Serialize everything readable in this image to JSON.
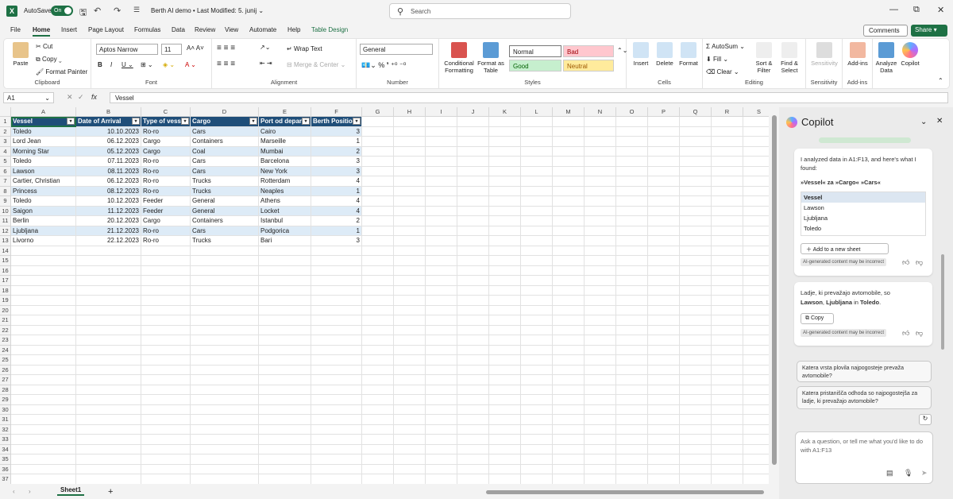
{
  "titlebar": {
    "app_letter": "X",
    "autosave_label": "AutoSave",
    "toggle": "On",
    "doc_title": "Berth AI demo • Last Modified: 5. junij ⌄",
    "search_placeholder": "Search",
    "controls": [
      "—",
      "⧉",
      "✕"
    ]
  },
  "tabs": [
    "File",
    "Home",
    "Insert",
    "Page Layout",
    "Formulas",
    "Data",
    "Review",
    "View",
    "Automate",
    "Help",
    "Table Design"
  ],
  "comments_label": "Comments",
  "share_label": "Share",
  "ribbon": {
    "clipboard": {
      "paste": "Paste",
      "cut": "Cut",
      "copy": "Copy",
      "format_painter": "Format Painter",
      "label": "Clipboard"
    },
    "font": {
      "name": "Aptos Narrow",
      "size": "11",
      "label": "Font"
    },
    "alignment": {
      "wrap": "Wrap Text",
      "merge": "Merge & Center",
      "label": "Alignment"
    },
    "number": {
      "format": "General",
      "label": "Number"
    },
    "styles": {
      "conditional": "Conditional Formatting",
      "format_table": "Format as Table",
      "normal": "Normal",
      "bad": "Bad",
      "good": "Good",
      "neutral": "Neutral",
      "label": "Styles"
    },
    "cells": {
      "insert": "Insert",
      "delete": "Delete",
      "format": "Format",
      "label": "Cells"
    },
    "editing": {
      "autosum": "AutoSum",
      "fill": "Fill",
      "clear": "Clear",
      "sort": "Sort & Filter",
      "find": "Find & Select",
      "label": "Editing"
    },
    "sensitivity": {
      "btn": "Sensitivity",
      "label": "Sensitivity"
    },
    "addins": {
      "btn": "Add-ins",
      "label": "Add-ins"
    },
    "analyze": "Analyze Data",
    "copilot": "Copilot"
  },
  "formula_bar": {
    "name_box": "A1",
    "fx": "fx",
    "value": "Vessel"
  },
  "columns": [
    "A",
    "B",
    "C",
    "D",
    "E",
    "F",
    "G",
    "H",
    "I",
    "J",
    "K",
    "L",
    "M",
    "N",
    "O",
    "P",
    "Q",
    "R",
    "S"
  ],
  "headers": [
    "Vessel",
    "Date of Arrival",
    "Type of vesse",
    "Cargo",
    "Port od depar",
    "Berth Position"
  ],
  "rows": [
    [
      "Toledo",
      "10.10.2023",
      "Ro-ro",
      "Cars",
      "Cairo",
      "3"
    ],
    [
      "Lord Jean",
      "06.12.2023",
      "Cargo",
      "Containers",
      "Marseille",
      "1"
    ],
    [
      "Morning Star",
      "05.12.2023",
      "Cargo",
      "Coal",
      "Mumbai",
      "2"
    ],
    [
      "Toledo",
      "07.11.2023",
      "Ro-ro",
      "Cars",
      "Barcelona",
      "3"
    ],
    [
      "Lawson",
      "08.11.2023",
      "Ro-ro",
      "Cars",
      "New York",
      "3"
    ],
    [
      "Cartier, Christian",
      "06.12.2023",
      "Ro-ro",
      "Trucks",
      "Rotterdam",
      "4"
    ],
    [
      "Princess",
      "08.12.2023",
      "Ro-ro",
      "Trucks",
      "Neaples",
      "1"
    ],
    [
      "Toledo",
      "10.12.2023",
      "Feeder",
      "General",
      "Athens",
      "4"
    ],
    [
      "Saigon",
      "11.12.2023",
      "Feeder",
      "General",
      "Locket",
      "4"
    ],
    [
      "Berlin",
      "20.12.2023",
      "Cargo",
      "Containers",
      "Istanbul",
      "2"
    ],
    [
      "Ljubljana",
      "21.12.2023",
      "Ro-ro",
      "Cars",
      "Podgorica",
      "1"
    ],
    [
      "Livorno",
      "22.12.2023",
      "Ro-ro",
      "Trucks",
      "Bari",
      "3"
    ]
  ],
  "row_numbers": [
    "1",
    "2",
    "3",
    "4",
    "5",
    "6",
    "7",
    "8",
    "9",
    "10",
    "11",
    "12",
    "13",
    "14",
    "15",
    "16",
    "17",
    "18",
    "19",
    "20",
    "21",
    "22",
    "23",
    "24",
    "25",
    "26",
    "27",
    "28",
    "29",
    "30",
    "31",
    "32",
    "33",
    "34",
    "35",
    "36",
    "37"
  ],
  "sheet_tab": "Sheet1",
  "copilot": {
    "title": "Copilot",
    "card1": {
      "intro": "I analyzed data in A1:F13, and here's what I found:",
      "heading": "»Vessel« za »Cargo« »Cars«",
      "table_header": "Vessel",
      "items": [
        "Lawson",
        "Ljubljana",
        "Toledo"
      ],
      "add_button": "Add to a new sheet",
      "disclaimer": "AI-generated content may be incorrect"
    },
    "card2": {
      "line1": "Ladje, ki prevažajo avtomobile, so",
      "line2_a": "Lawson",
      "line2_b": ", ",
      "line2_c": "Ljubljana",
      "line2_d": " in ",
      "line2_e": "Toledo",
      "line2_f": ".",
      "copy": "Copy",
      "disclaimer": "AI-generated content may be incorrect"
    },
    "suggestions": [
      "Katera vrsta plovila najpogosteje prevaža avtomobile?",
      "Katera pristanišča odhoda so najpogostejša za ladje, ki prevažajo avtomobile?"
    ],
    "ask_placeholder": "Ask a question, or tell me what you'd like to do with A1:F13"
  },
  "colors": {
    "accent": "#1e7145",
    "table_header": "#1f4e79",
    "band": "#ddebf7"
  }
}
